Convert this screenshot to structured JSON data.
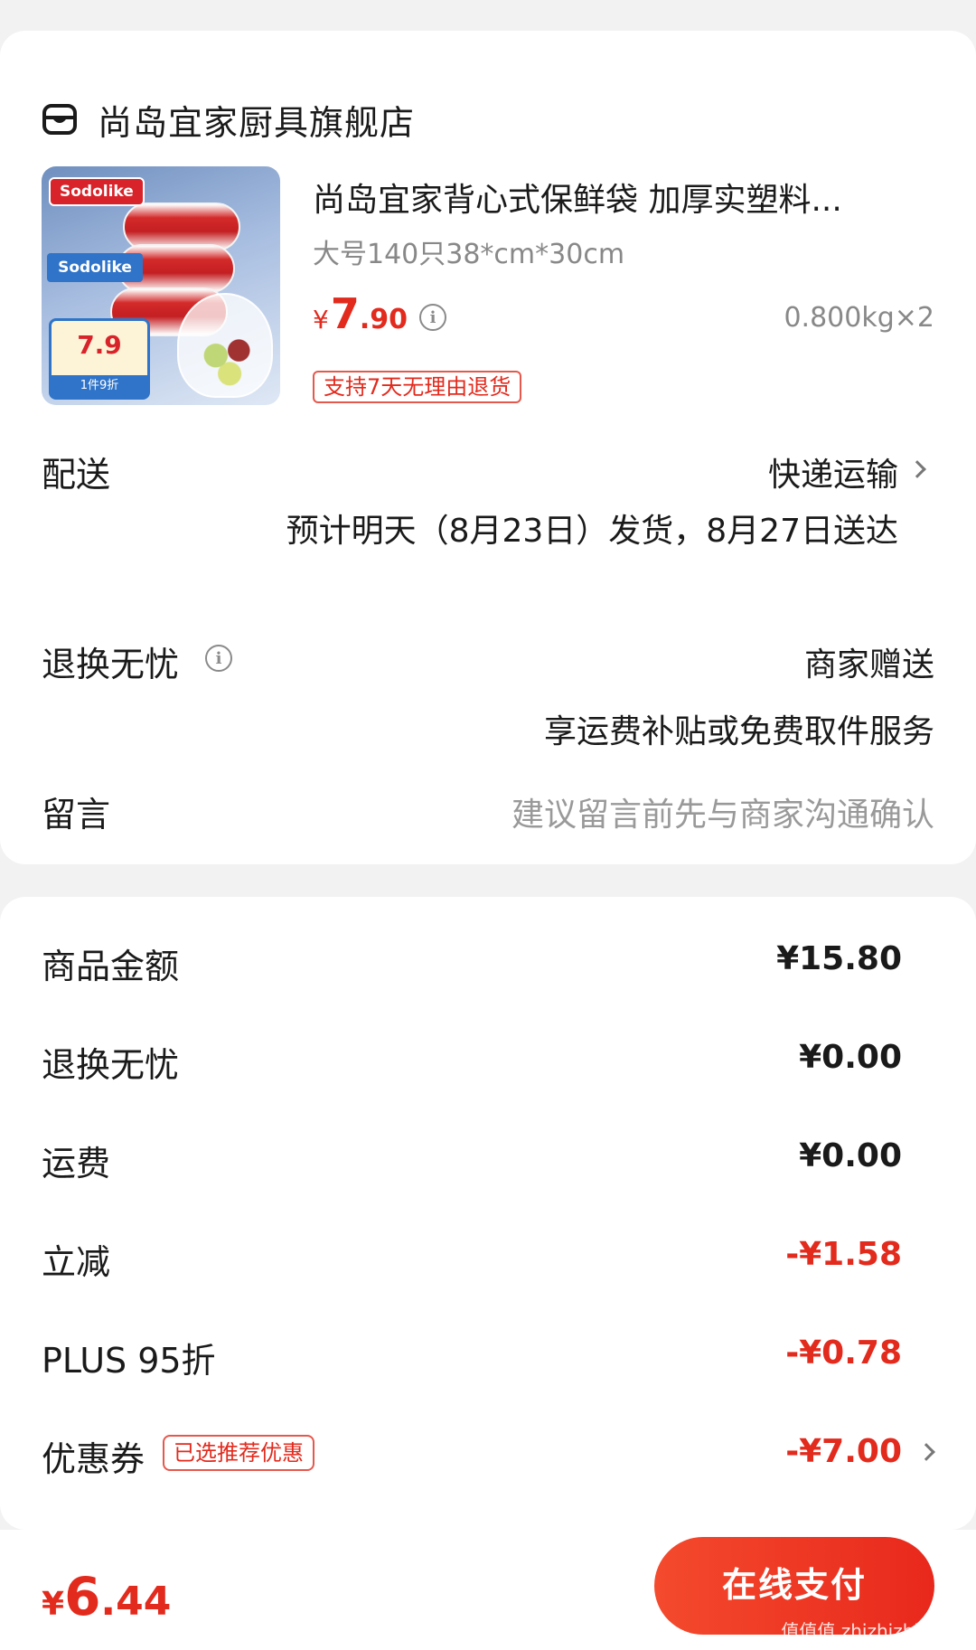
{
  "store": {
    "name": "尚岛宜家厨具旗舰店",
    "icon": "store-icon"
  },
  "product": {
    "title": "尚岛宜家背心式保鲜袋 加厚实塑料...",
    "spec": "大号140只38*cm*30cm",
    "price_symbol": "¥",
    "price_int": "7",
    "price_dec": ".90",
    "weight_qty": "0.800kg×2",
    "return_tag": "支持7天无理由退货",
    "image_brand": "Sodolike",
    "image_tag": "Sodolike",
    "image_price": "7.9",
    "image_footer": "1件9折"
  },
  "delivery": {
    "label": "配送",
    "method": "快递运输",
    "eta": "预计明天（8月23日）发货，8月27日送达"
  },
  "returns": {
    "label": "退换无忧",
    "value": "商家赠送",
    "detail": "享运费补贴或免费取件服务"
  },
  "message": {
    "label": "留言",
    "placeholder": "建议留言前先与商家沟通确认"
  },
  "summary": {
    "goods_label": "商品金额",
    "goods_value": "¥15.80",
    "returns_label": "退换无忧",
    "returns_value": "¥0.00",
    "shipping_label": "运费",
    "shipping_value": "¥0.00",
    "discount_label": "立减",
    "discount_value": "-¥1.58",
    "plus_label": "PLUS 95折",
    "plus_value": "-¥0.78",
    "coupon_label": "优惠券",
    "coupon_tag": "已选推荐优惠",
    "coupon_value": "-¥7.00"
  },
  "footer": {
    "total_symbol": "¥",
    "total_int": "6",
    "total_dec": ".44",
    "pay_label": "在线支付",
    "watermark": "值值值 zhizhizhi.com"
  },
  "colors": {
    "accent": "#e22a1d",
    "background": "#f2f2f2",
    "card": "#ffffff"
  }
}
